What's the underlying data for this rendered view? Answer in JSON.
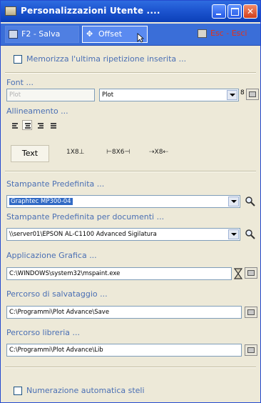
{
  "window": {
    "title": "Personalizzazioni Utente ...."
  },
  "toolbar": {
    "save_label": "F2 - Salva",
    "offset_label": "Offset",
    "exit_label": "Esc - Esci"
  },
  "options": {
    "remember_last_repeat": {
      "label": "Memorizza l'ultima ripetizione inserita ...",
      "checked": false
    },
    "auto_numbering": {
      "label": "Numerazione automatica steli",
      "checked": false
    }
  },
  "font": {
    "header": "Font ...",
    "preview_value": "Plot",
    "font_name": "Plot",
    "size": "8"
  },
  "alignment": {
    "header": "Allineamento ...",
    "buttons": [
      {
        "name": "left",
        "active": false
      },
      {
        "name": "center",
        "active": true
      },
      {
        "name": "right",
        "active": false
      },
      {
        "name": "justify",
        "active": false
      }
    ]
  },
  "text_mode": {
    "text_button": "Text",
    "dim_options": [
      "1X8⊥",
      "⊢8X6⊣",
      "⇢X8⇠"
    ]
  },
  "default_printer": {
    "header": "Stampante Predefinita ...",
    "value": "Graphtec MP300-04"
  },
  "document_printer": {
    "header": "Stampante Predefinita per documenti ...",
    "value": "\\\\server01\\EPSON AL-C1100 Advanced Sigilatura"
  },
  "graphics_app": {
    "header": "Applicazione Grafica ...",
    "value": "C:\\WINDOWS\\system32\\mspaint.exe"
  },
  "save_path": {
    "header": "Percorso di salvataggio ...",
    "value": "C:\\Programmi\\Plot Advance\\Save"
  },
  "library_path": {
    "header": "Percorso libreria ...",
    "value": "C:\\Programmi\\Plot Advance\\Lib"
  },
  "colors": {
    "title_bar": "#1d55d0",
    "toolbar": "#3a6ed8",
    "panel": "#ede9d8",
    "section_text": "#4a6fb4",
    "selection": "#316ac5",
    "exit_text": "#e0341c"
  },
  "icons": {
    "app": "app-icon",
    "save": "floppy-icon",
    "offset": "offset-icon",
    "exit": "exit-icon",
    "search": "magnifier-icon",
    "hourglass": "hourglass-icon",
    "browse": "browse-icon"
  }
}
